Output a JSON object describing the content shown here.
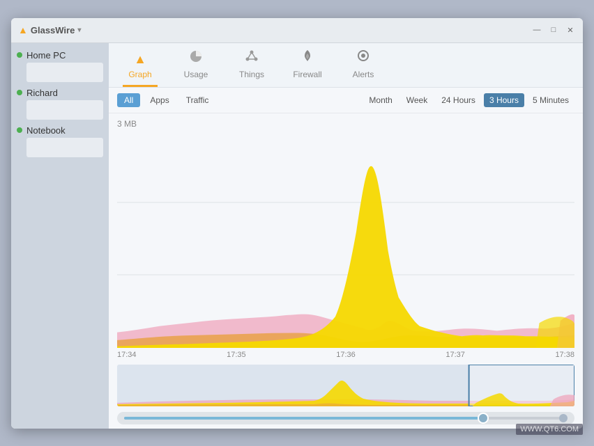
{
  "app": {
    "title": "GlassWire",
    "watermark": "WWW.QT6.COM"
  },
  "window_controls": {
    "minimize": "—",
    "maximize": "□",
    "close": "✕"
  },
  "nav": {
    "tabs": [
      {
        "id": "graph",
        "label": "Graph",
        "icon": "▲",
        "active": true
      },
      {
        "id": "usage",
        "label": "Usage",
        "icon": "◑"
      },
      {
        "id": "things",
        "label": "Things",
        "icon": "❋"
      },
      {
        "id": "firewall",
        "label": "Firewall",
        "icon": "🔥"
      },
      {
        "id": "alerts",
        "label": "Alerts",
        "icon": "◎"
      }
    ]
  },
  "filter_bar": {
    "view_buttons": [
      {
        "id": "all",
        "label": "All",
        "active": true
      },
      {
        "id": "apps",
        "label": "Apps",
        "active": false
      },
      {
        "id": "traffic",
        "label": "Traffic",
        "active": false
      }
    ],
    "time_buttons": [
      {
        "id": "month",
        "label": "Month",
        "active": false
      },
      {
        "id": "week",
        "label": "Week",
        "active": false
      },
      {
        "id": "24hours",
        "label": "24 Hours",
        "active": false
      },
      {
        "id": "3hours",
        "label": "3 Hours",
        "active": true
      },
      {
        "id": "5minutes",
        "label": "5 Minutes",
        "active": false
      }
    ]
  },
  "chart": {
    "y_label": "3 MB",
    "x_labels": [
      "17:34",
      "17:35",
      "17:36",
      "17:37",
      "17:38"
    ]
  },
  "sidebar": {
    "items": [
      {
        "id": "home-pc",
        "label": "Home PC",
        "status": "online"
      },
      {
        "id": "richard",
        "label": "Richard",
        "status": "online"
      },
      {
        "id": "notebook",
        "label": "Notebook",
        "status": "online"
      }
    ]
  }
}
